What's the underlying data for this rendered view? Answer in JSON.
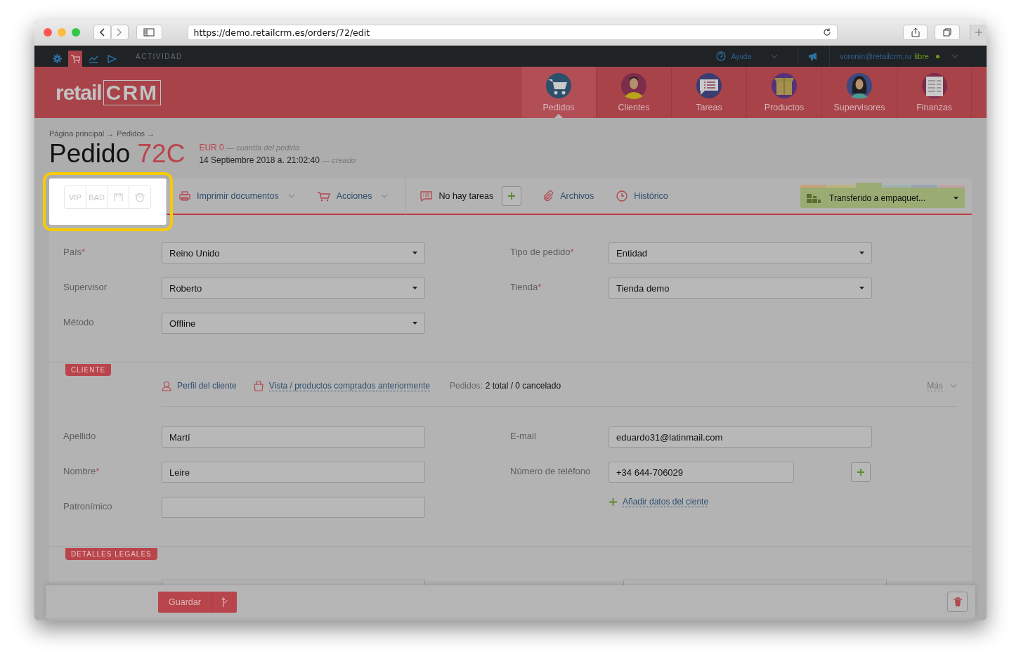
{
  "browser": {
    "url": "https://demo.retailcrm.es/orders/72/edit"
  },
  "topbar": {
    "icons": [
      {
        "kind": "gear",
        "selected": false
      },
      {
        "kind": "cart",
        "selected": true
      },
      {
        "kind": "chart",
        "selected": false
      },
      {
        "kind": "play",
        "selected": false
      }
    ],
    "activity": "ACTIVIDAD",
    "help": "Ayuda",
    "user": "voronin@retailcrm.ru",
    "status": "libre"
  },
  "logo": {
    "text": "retail",
    "mark": "CRM"
  },
  "nav": [
    {
      "label": "Pedidos",
      "kind": "cart",
      "selected": true
    },
    {
      "label": "Clientes",
      "kind": "man",
      "selected": false
    },
    {
      "label": "Tareas",
      "kind": "chat",
      "selected": false
    },
    {
      "label": "Productos",
      "kind": "box",
      "selected": false
    },
    {
      "label": "Supervisores",
      "kind": "woman",
      "selected": false
    },
    {
      "label": "Finanzas",
      "kind": "ledger",
      "selected": false
    }
  ],
  "breadcrumb": [
    "Página principal →",
    "Pedidos →"
  ],
  "order": {
    "title": "Pedido",
    "number": "72C",
    "amount": "EUR 0",
    "amount_note": "— cuantía del pedido",
    "date": "14 Septiembre 2018 a. 21:02:40",
    "date_note": "— creado"
  },
  "tags": [
    {
      "label": "VIP",
      "kind": "text"
    },
    {
      "label": "BAD",
      "kind": "text"
    },
    {
      "kind": "flag"
    },
    {
      "kind": "alarm"
    }
  ],
  "toolbar": {
    "print": "Imprimir documentos",
    "actions": "Acciones",
    "tasks": "No hay tareas",
    "files": "Archivos",
    "history": "Histórico"
  },
  "status": {
    "label": "Transferido a empaquet...",
    "stages": [
      {
        "color": "#c7a27c",
        "selected": false
      },
      {
        "color": "#bcb47e",
        "selected": false
      },
      {
        "color": "#9aab73",
        "selected": true
      },
      {
        "color": "#9db1b1",
        "selected": false
      },
      {
        "color": "#97a5b2",
        "selected": false
      },
      {
        "color": "#c2a2a7",
        "selected": false
      }
    ]
  },
  "order_fields": [
    {
      "label": "País",
      "required_mark": "*",
      "value": "Reino Unido",
      "kind": "select"
    },
    {
      "label": "Tipo de pedido",
      "required_mark": "*",
      "value": "Entidad",
      "kind": "select"
    },
    {
      "label": "Supervisor",
      "value": "Roberto",
      "kind": "select"
    },
    {
      "label": "Tienda",
      "required_mark": "*",
      "value": "Tienda demo",
      "kind": "select"
    },
    {
      "label": "Método",
      "value": "Offline",
      "kind": "select"
    }
  ],
  "customer": {
    "section": "CLIENTE",
    "profile": "Perfil del cliente",
    "history": "Vista / productos comprados anteriormente",
    "orders_label": "Pedidos:",
    "orders": "2 total / 0 cancelado",
    "more": "Más",
    "left": [
      {
        "label": "Apellido",
        "value": "Martí"
      },
      {
        "label": "Nombre",
        "required_mark": "*",
        "value": "Leire"
      },
      {
        "label": "Patronímico"
      }
    ],
    "email": {
      "label": "E-mail",
      "value": "eduardo31@latinmail.com"
    },
    "phone": {
      "label": "Número de teléfono",
      "value": "+34 644-706029"
    },
    "add": "Añadir datos del ciente"
  },
  "legal": {
    "section": "DETALLES LEGALES"
  },
  "footer": {
    "save": "Guardar"
  }
}
